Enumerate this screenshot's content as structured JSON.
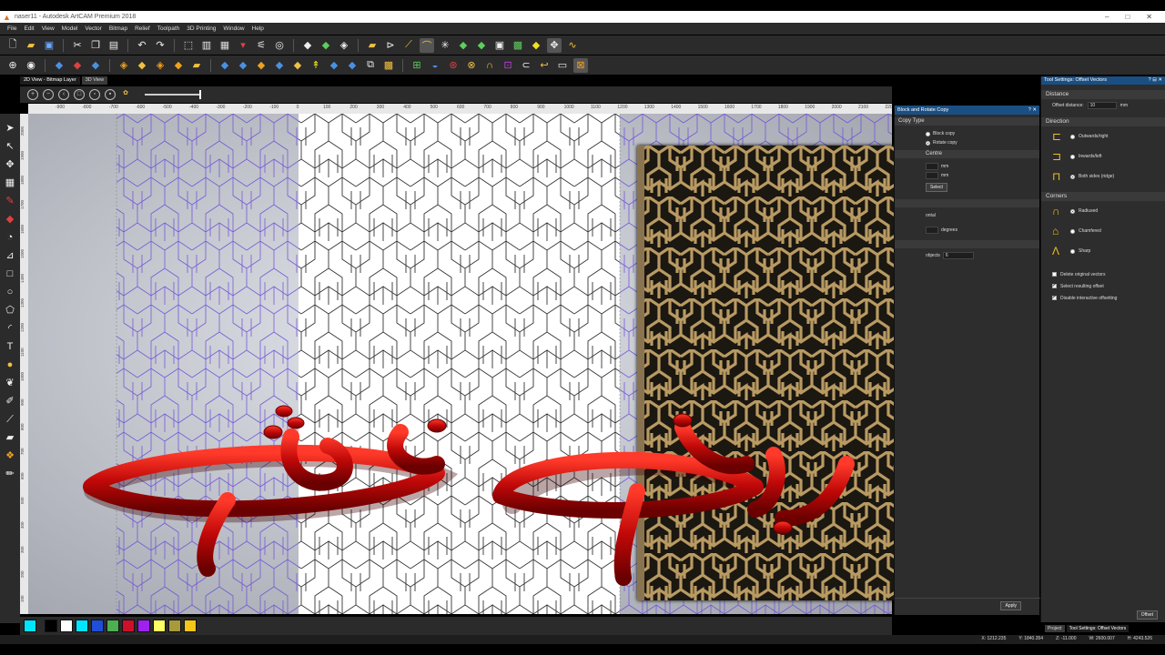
{
  "window": {
    "title": "naser11 - Autodesk ArtCAM Premium 2018",
    "app_icon": "artcam-logo-icon",
    "controls": [
      "–",
      "□",
      "✕"
    ]
  },
  "menu": [
    "File",
    "Edit",
    "View",
    "Model",
    "Vector",
    "Bitmap",
    "Relief",
    "Toolpath",
    "3D Printing",
    "Window",
    "Help"
  ],
  "view_tabs": [
    "2D View - Bitmap Layer",
    "3D View"
  ],
  "ruler": {
    "top": [
      "-900",
      "-800",
      "-700",
      "-600",
      "-500",
      "-400",
      "-300",
      "-200",
      "-100",
      "0",
      "100",
      "200",
      "300",
      "400",
      "500",
      "600",
      "700",
      "800",
      "900",
      "1000",
      "1100",
      "1200",
      "1300",
      "1400",
      "1500",
      "1600",
      "1700",
      "1800",
      "1900",
      "2000",
      "2100",
      "2200"
    ],
    "left": [
      "2000",
      "1900",
      "1800",
      "1700",
      "1600",
      "1500",
      "1400",
      "1300",
      "1200",
      "1100",
      "1000",
      "900",
      "800",
      "700",
      "600",
      "500",
      "400",
      "300",
      "200",
      "100",
      "0"
    ]
  },
  "overlay_text": "بدون شغف",
  "dialog": {
    "title": "Block and Rotate Copy",
    "controls": [
      "?",
      "✕"
    ],
    "copy_type_label": "Copy Type",
    "block_copy": "Block copy",
    "rotate_copy": "Rotate copy",
    "centre_label": "Centre",
    "unit_mm_1": "mm",
    "unit_mm_2": "mm",
    "select_button": "Select",
    "ontal_label": "ontal",
    "degrees_label": "degrees",
    "objects_label": "objects",
    "objects_value": "6",
    "apply_button": "Apply"
  },
  "tool_settings": {
    "title": "Tool Settings: Offset Vectors",
    "controls": [
      "?",
      "⊟",
      "✕"
    ],
    "distance_section": "Distance",
    "offset_distance_label": "Offset distance:",
    "offset_distance_value": "10",
    "offset_unit": "mm",
    "direction_section": "Direction",
    "directions": [
      "Outwards/right",
      "Inwards/left",
      "Both sides (ridge)"
    ],
    "corners_section": "Corners",
    "corners": [
      "Radiused",
      "Chamfered",
      "Sharp"
    ],
    "checks": [
      {
        "label": "Delete original vectors",
        "checked": false
      },
      {
        "label": "Select resulting offset",
        "checked": true
      },
      {
        "label": "Disable interactive offsetting",
        "checked": true
      }
    ],
    "offset_button": "Offset"
  },
  "bottom_tabs": [
    "Project",
    "Tool Settings: Offset Vectors"
  ],
  "status": {
    "x": "X: 1212.235",
    "y": "Y: 1840.354",
    "z": "Z: -11.000",
    "w": "W: 2600.007",
    "h": "H: 4243.526"
  },
  "palette_colors": [
    "#00e5ff",
    "#000000",
    "#ffffff",
    "#00e5ff",
    "#1f4fd8",
    "#4caf50",
    "#d0102a",
    "#a020f0",
    "#ffff66",
    "#a89a3a",
    "#f5c518"
  ]
}
